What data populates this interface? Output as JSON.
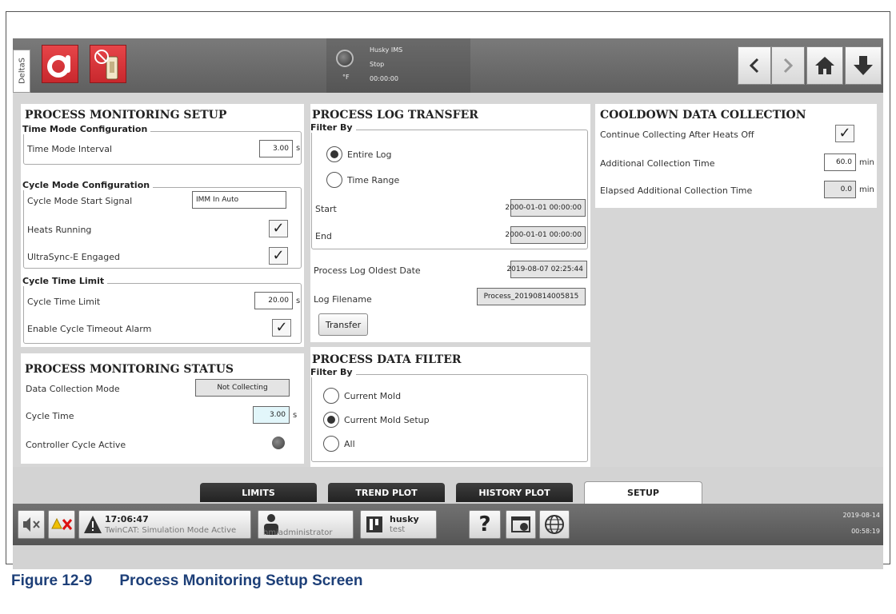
{
  "header": {
    "side_tab": "DeltaS",
    "status_title": "Husky IMS",
    "status_state": "Stop",
    "status_unit": "°F",
    "status_time": "00:00:00"
  },
  "monitoring_setup": {
    "title": "PROCESS MONITORING SETUP",
    "time_mode": {
      "group": "Time Mode Configuration",
      "interval_label": "Time Mode Interval",
      "interval_value": "3.00",
      "interval_unit": "s"
    },
    "cycle_mode": {
      "group": "Cycle Mode Configuration",
      "start_signal_label": "Cycle Mode Start Signal",
      "start_signal_value": "IMM In Auto",
      "heats_running_label": "Heats Running",
      "ultrasync_label": "UltraSync-E Engaged"
    },
    "cycle_time_limit": {
      "group": "Cycle Time Limit",
      "limit_label": "Cycle Time Limit",
      "limit_value": "20.00",
      "limit_unit": "s",
      "timeout_alarm_label": "Enable Cycle Timeout Alarm"
    }
  },
  "monitoring_status": {
    "title": "PROCESS MONITORING STATUS",
    "collection_mode_label": "Data Collection Mode",
    "collection_mode_value": "Not Collecting",
    "cycle_time_label": "Cycle Time",
    "cycle_time_value": "3.00",
    "cycle_time_unit": "s",
    "controller_active_label": "Controller Cycle Active"
  },
  "log_transfer": {
    "title": "PROCESS LOG TRANSFER",
    "filter_group": "Filter By",
    "opt_entire": "Entire Log",
    "opt_range": "Time Range",
    "start_label": "Start",
    "start_value": "2000-01-01 00:00:00",
    "end_label": "End",
    "end_value": "2000-01-01 00:00:00",
    "oldest_label": "Process Log Oldest Date",
    "oldest_value": "2019-08-07 02:25:44",
    "filename_label": "Log Filename",
    "filename_value": "Process_20190814005815",
    "transfer_button": "Transfer"
  },
  "data_filter": {
    "title": "PROCESS DATA FILTER",
    "filter_group": "Filter By",
    "opt_current_mold": "Current Mold",
    "opt_current_setup": "Current Mold Setup",
    "opt_all": "All"
  },
  "cooldown": {
    "title": "COOLDOWN DATA COLLECTION",
    "continue_label": "Continue Collecting After Heats Off",
    "additional_label": "Additional Collection Time",
    "additional_value": "60.0",
    "additional_unit": "min",
    "elapsed_label": "Elapsed Additional Collection Time",
    "elapsed_value": "0.0",
    "elapsed_unit": "min"
  },
  "tabs": {
    "limits": "LIMITS",
    "trend": "TREND PLOT",
    "history": "HISTORY PLOT",
    "setup": "SETUP"
  },
  "footer": {
    "alarm_time": "17:06:47",
    "alarm_text": "TwinCAT: Simulation Mode Active",
    "user": "hmiadministrator",
    "profile_name": "husky",
    "profile_sub": "test",
    "help": "?",
    "date": "2019-08-14",
    "time": "00:58:19"
  },
  "caption": {
    "number": "Figure 12-9",
    "text": "Process Monitoring Setup Screen"
  },
  "colors": {
    "red_button": "#d1343a",
    "caption_blue": "#1d3f78",
    "highlight_cyan": "#e2f6fa"
  }
}
